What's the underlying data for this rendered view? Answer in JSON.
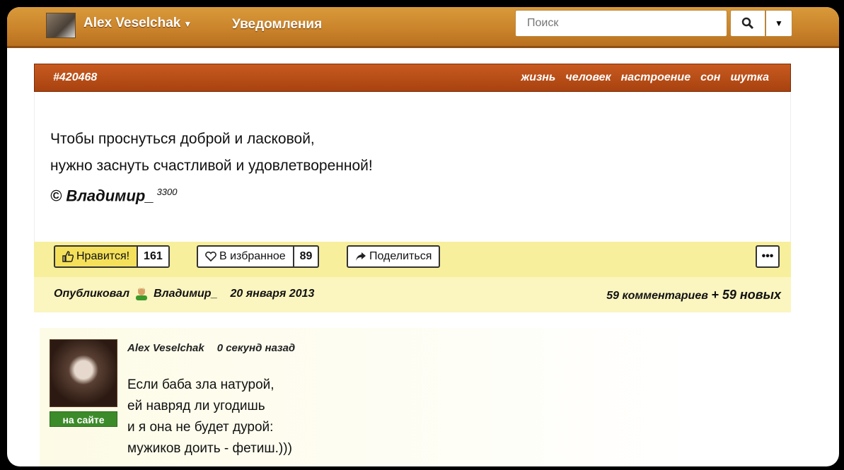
{
  "navbar": {
    "user_name": "Alex Veselchak",
    "notifications_label": "Уведомления",
    "search_placeholder": "Поиск"
  },
  "quote": {
    "id": "#420468",
    "tags": [
      "жизнь",
      "человек",
      "настроение",
      "сон",
      "шутка"
    ],
    "lines": [
      "Чтобы проснуться доброй и ласковой,",
      "нужно заснуть счастливой и удовлетворенной!"
    ],
    "author": "© Владимир_",
    "author_rating": "3300"
  },
  "actions": {
    "like_label": "Нравится!",
    "like_count": "161",
    "fav_label": "В избранное",
    "fav_count": "89",
    "share_label": "Поделиться",
    "more_label": "•••"
  },
  "published": {
    "prefix": "Опубликовал",
    "author": "Владимир_",
    "date": "20 января 2013",
    "comments": "59 комментариев",
    "new_comments": "+ 59 новых"
  },
  "comment": {
    "author": "Alex Veselchak",
    "time": "0 секунд назад",
    "online_badge": "на сайте",
    "lines": [
      "Если баба зла натурой,",
      "ей навряд ли угодишь",
      "и я она не будет дурой:",
      "мужиков доить - фетиш.)))"
    ]
  },
  "colors": {
    "navbar": "#c9822a",
    "quote_bar": "#b84a15",
    "action_bar": "#f7ef9c",
    "online_badge": "#3c8b2a"
  }
}
